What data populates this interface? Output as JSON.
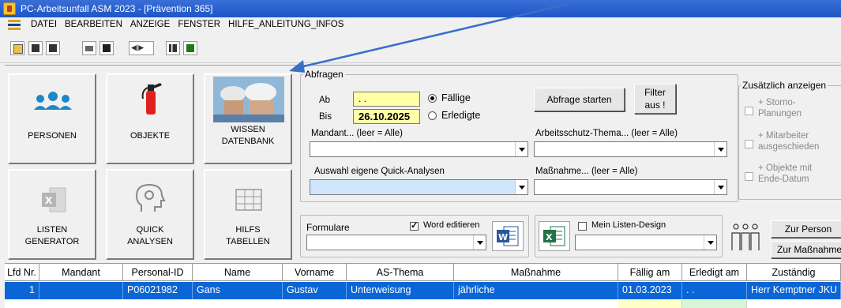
{
  "window": {
    "title": "PC-Arbeitsunfall ASM 2023 - [Prävention 365]"
  },
  "menu": [
    "DATEI",
    "BEARBEITEN",
    "ANZEIGE",
    "FENSTER",
    "HILFE_ANLEITUNG_INFOS"
  ],
  "toolbar_icons": [
    "folder-open-icon",
    "document-icon",
    "trash-icon",
    "print-icon",
    "save-icon",
    "first-last-nav-icon",
    "table-icon",
    "table-green-icon"
  ],
  "big_buttons": {
    "personen": "PERSONEN",
    "objekte": "OBJEKTE",
    "wissen": "WISSEN\nDATENBANK",
    "listen": "LISTEN\nGENERATOR",
    "quick": "QUICK\nANALYSEN",
    "hilfs": "HILFS\nTABELLEN"
  },
  "abfragen": {
    "title": "Abfragen",
    "ab_label": "Ab",
    "ab_value": ". .",
    "bis_label": "Bis",
    "bis_value": "26.10.2025",
    "radio_faellige": "Fällige",
    "radio_erledigte": "Erledigte",
    "selected": "Fällige",
    "start_button": "Abfrage starten",
    "filter_button": "Filter\naus !",
    "mandant_label": "Mandant... (leer = Alle)",
    "thema_label": "Arbeitsschutz-Thema... (leer = Alle)",
    "quick_label": "Auswahl eigene Quick-Analysen",
    "massnahme_label": "Maßnahme... (leer = Alle)"
  },
  "zusaetzlich": {
    "title": "Zusätzlich anzeigen",
    "items": [
      "+ Storno-\nPlanungen",
      "+ Mitarbeiter\nausgeschieden",
      "+ Objekte mit\nEnde-Datum"
    ]
  },
  "formulare": {
    "label": "Formulare",
    "word_check": "Word editieren",
    "word_checked": true,
    "listen_design": "Mein Listen-Design",
    "listen_checked": false
  },
  "nav_buttons": {
    "person": "Zur Person",
    "massnahme": "Zur Maßnahme"
  },
  "table": {
    "columns": [
      "Lfd Nr.",
      "Mandant",
      "Personal-ID",
      "Name",
      "Vorname",
      "AS-Thema",
      "Maßnahme",
      "Fällig am",
      "Erledigt am",
      "Zuständig"
    ],
    "rows": [
      [
        "1",
        "",
        "P06021982",
        "Gans",
        "Gustav",
        "Unterweisung",
        "jährliche",
        "01.03.2023",
        ". .",
        "Herr Kemptner JKU"
      ]
    ]
  },
  "colors": {
    "accent": "#0a66d6",
    "titlebar": "#1e56c6",
    "highlight_field": "#ffffa8"
  }
}
